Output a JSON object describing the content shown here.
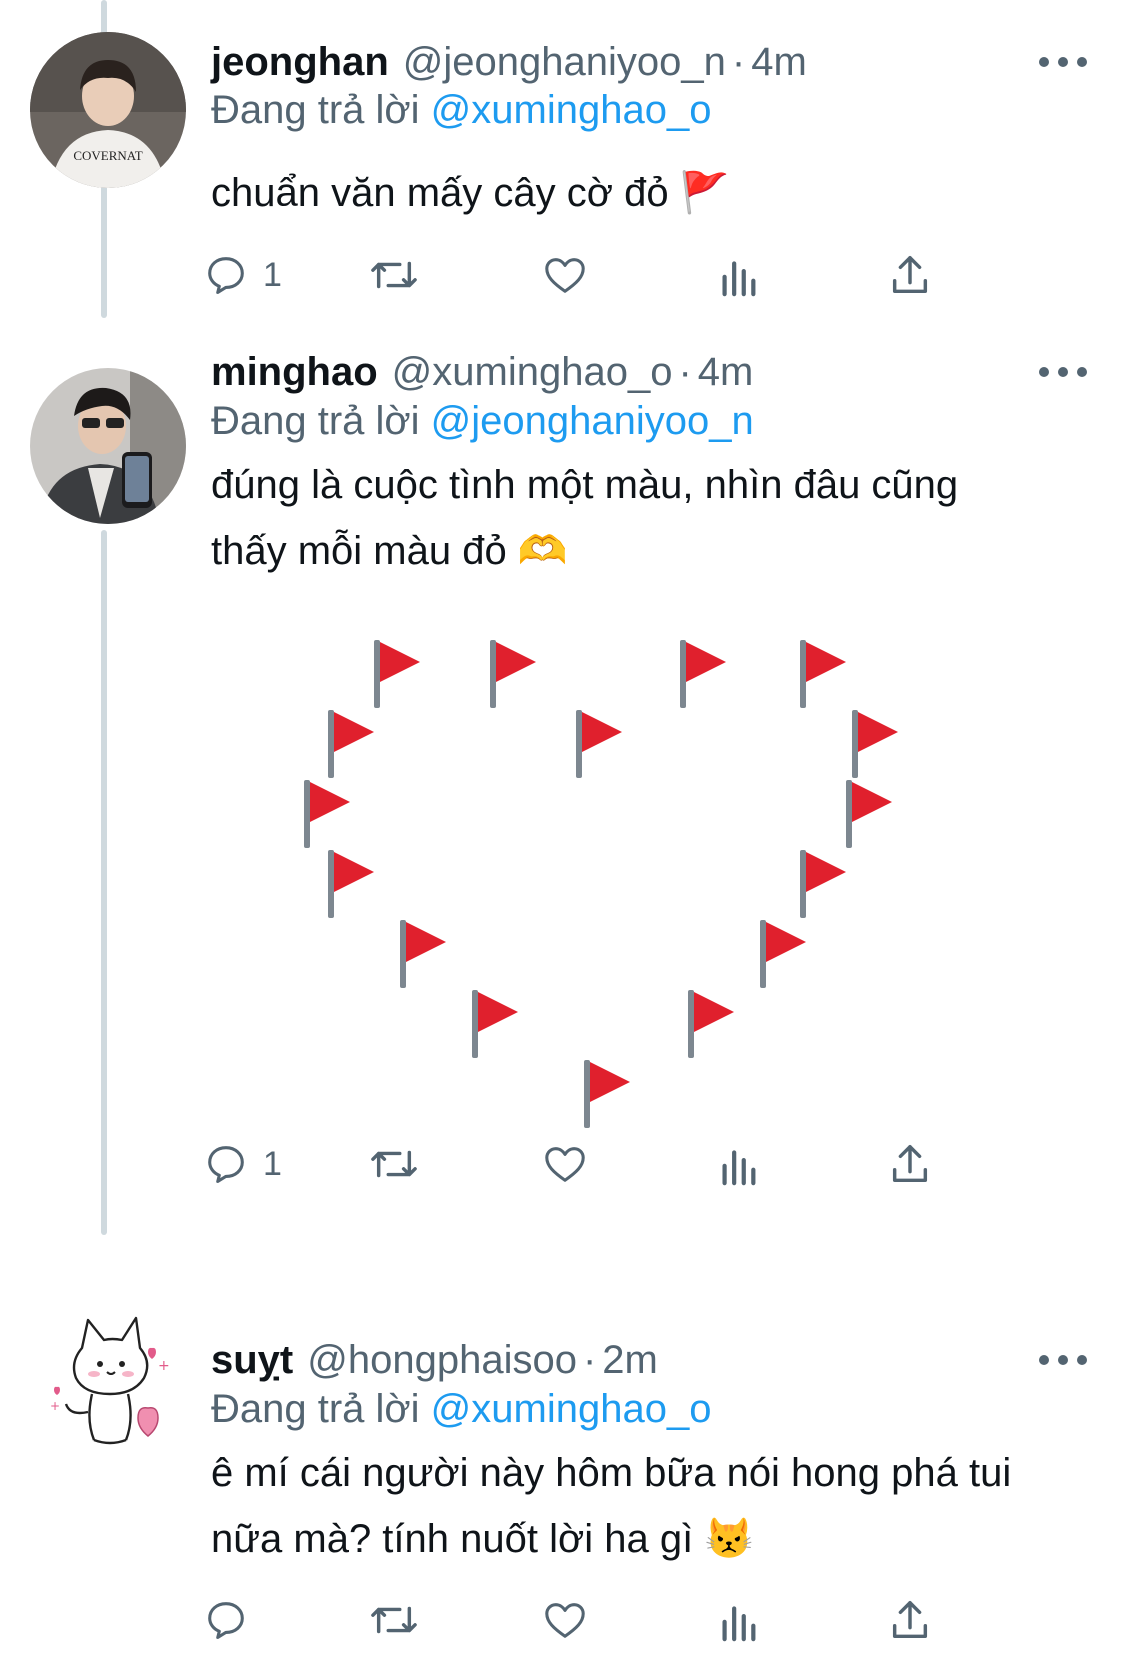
{
  "tweets": [
    {
      "name": "jeonghan",
      "handle": "@jeonghaniyoo_n",
      "separator": "·",
      "time": "4m",
      "replying_prefix": "Đang trả lời",
      "replying_to": "@xuminghao_o",
      "text": "chuẩn văn mấy cây cờ đỏ",
      "emoji": "🚩",
      "reply_count": "1",
      "avatar_shirt_text": "COVERNAT"
    },
    {
      "name": "minghao",
      "handle": "@xuminghao_o",
      "separator": "·",
      "time": "4m",
      "replying_prefix": "Đang trả lời",
      "replying_to": "@jeonghaniyoo_n",
      "text_line1": "đúng là cuộc tình một màu, nhìn đâu cũng",
      "text_line2": "thấy mỗi màu đỏ",
      "emoji": "🫶",
      "reply_count": "1",
      "image": {
        "description_icon": "red-flags-heart",
        "flag_count": 17
      }
    },
    {
      "name": "suỵt",
      "handle": "@hongphaisoo",
      "separator": "·",
      "time": "2m",
      "replying_prefix": "Đang trả lời",
      "replying_to": "@xuminghao_o",
      "text_line1": "ê mí cái người này hôm bữa nói hong phá tui",
      "text_line2": "nữa mà? tính nuốt lời ha gì",
      "emoji": "😾",
      "reply_count": ""
    }
  ],
  "icons": [
    "reply-icon",
    "retweet-icon",
    "like-icon",
    "views-icon",
    "share-icon",
    "more-icon"
  ],
  "colors": {
    "link": "#1d9bf0",
    "secondary": "#536471",
    "text": "#0f1419",
    "flag": "#e0202d",
    "thread_line": "#cfd9de"
  }
}
